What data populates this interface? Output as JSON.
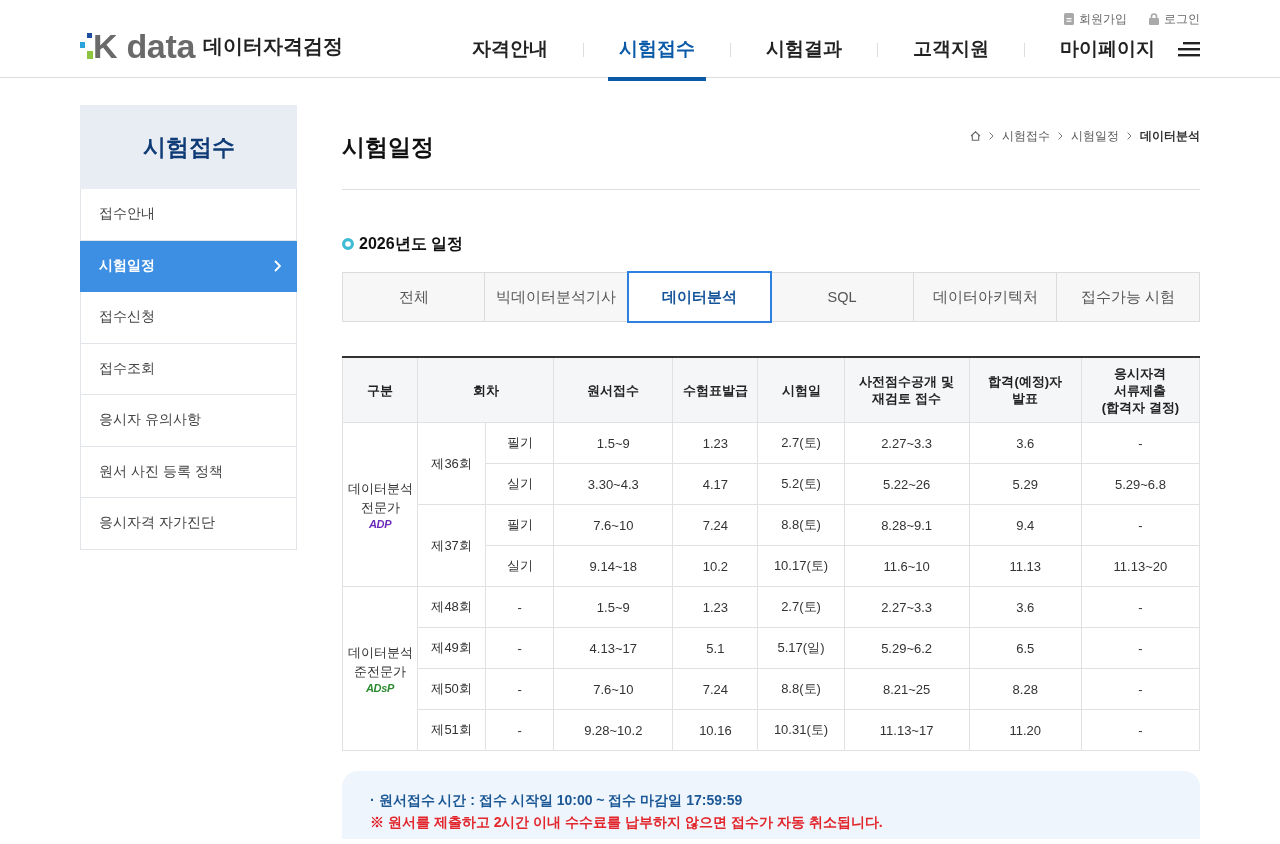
{
  "header": {
    "logo": {
      "wordmark": "K data",
      "title": "데이터자격검정"
    },
    "top_links": [
      {
        "kind": "join",
        "label": "회원가입"
      },
      {
        "kind": "login",
        "label": "로그인"
      }
    ],
    "nav": [
      {
        "label": "자격안내",
        "selected": false
      },
      {
        "label": "시험접수",
        "selected": true
      },
      {
        "label": "시험결과",
        "selected": false
      },
      {
        "label": "고객지원",
        "selected": false
      },
      {
        "label": "마이페이지",
        "selected": false
      }
    ]
  },
  "sidebar": {
    "title": "시험접수",
    "items": [
      {
        "label": "접수안내",
        "selected": false
      },
      {
        "label": "시험일정",
        "selected": true
      },
      {
        "label": "접수신청",
        "selected": false
      },
      {
        "label": "접수조회",
        "selected": false
      },
      {
        "label": "응시자 유의사항",
        "selected": false
      },
      {
        "label": "원서 사진 등록 정책",
        "selected": false
      },
      {
        "label": "응시자격 자가진단",
        "selected": false
      }
    ]
  },
  "content": {
    "title": "시험일정",
    "breadcrumb": [
      {
        "label": "시험접수",
        "current": false
      },
      {
        "label": "시험일정",
        "current": false
      },
      {
        "label": "데이터분석",
        "current": true
      }
    ],
    "section_title": "2026년도 일정",
    "tabs": [
      {
        "label": "전체",
        "selected": false
      },
      {
        "label": "빅데이터분석기사",
        "selected": false
      },
      {
        "label": "데이터분석",
        "selected": true
      },
      {
        "label": "SQL",
        "selected": false
      },
      {
        "label": "데이터아키텍처",
        "selected": false
      },
      {
        "label": "접수가능 시험",
        "selected": false
      }
    ]
  },
  "table": {
    "columns": [
      "구분",
      "회차",
      "원서접수",
      "수험표발급",
      "시험일",
      "사전점수공개 및\n재검토 접수",
      "합격(예정)자\n발표",
      "응시자격\n서류제출\n(합격자 결정)"
    ],
    "groups": [
      {
        "name": "데이터분석\n전문가",
        "logo": "ADP",
        "color": "#6a2cb8",
        "rounds": [
          {
            "round": "제36회",
            "parts": [
              {
                "stage": "필기",
                "cells": [
                  "1.5~9",
                  "1.23",
                  "2.7(토)",
                  "2.27~3.3",
                  "3.6",
                  "-"
                ]
              },
              {
                "stage": "실기",
                "cells": [
                  "3.30~4.3",
                  "4.17",
                  "5.2(토)",
                  "5.22~26",
                  "5.29",
                  "5.29~6.8"
                ]
              }
            ]
          },
          {
            "round": "제37회",
            "parts": [
              {
                "stage": "필기",
                "cells": [
                  "7.6~10",
                  "7.24",
                  "8.8(토)",
                  "8.28~9.1",
                  "9.4",
                  "-"
                ]
              },
              {
                "stage": "실기",
                "cells": [
                  "9.14~18",
                  "10.2",
                  "10.17(토)",
                  "11.6~10",
                  "11.13",
                  "11.13~20"
                ]
              }
            ]
          }
        ]
      },
      {
        "name": "데이터분석\n준전문가",
        "logo": "ADsP",
        "color": "#2b8a2e",
        "rounds": [
          {
            "round": "제48회",
            "parts": [
              {
                "stage": "-",
                "cells": [
                  "1.5~9",
                  "1.23",
                  "2.7(토)",
                  "2.27~3.3",
                  "3.6",
                  "-"
                ]
              }
            ]
          },
          {
            "round": "제49회",
            "parts": [
              {
                "stage": "-",
                "cells": [
                  "4.13~17",
                  "5.1",
                  "5.17(일)",
                  "5.29~6.2",
                  "6.5",
                  "-"
                ]
              }
            ]
          },
          {
            "round": "제50회",
            "parts": [
              {
                "stage": "-",
                "cells": [
                  "7.6~10",
                  "7.24",
                  "8.8(토)",
                  "8.21~25",
                  "8.28",
                  "-"
                ]
              }
            ]
          },
          {
            "round": "제51회",
            "parts": [
              {
                "stage": "-",
                "cells": [
                  "9.28~10.2",
                  "10.16",
                  "10.31(토)",
                  "11.13~17",
                  "11.20",
                  "-"
                ]
              }
            ]
          }
        ]
      }
    ]
  },
  "notice": {
    "lines": [
      {
        "kind": "info",
        "text": "· 원서접수 시간 : 접수 시작일 10:00 ~ 접수 마감일 17:59:59"
      },
      {
        "kind": "warning",
        "text": "※ 원서를 제출하고 2시간 이내 수수료를 납부하지 않으면 접수가 자동 취소됩니다."
      }
    ]
  }
}
